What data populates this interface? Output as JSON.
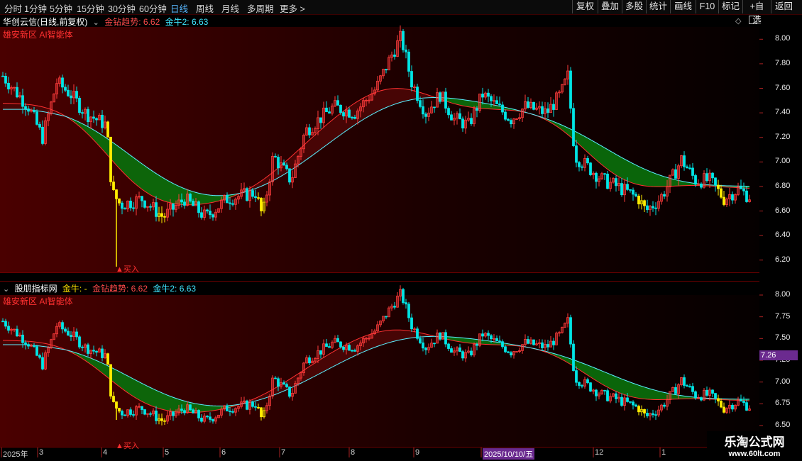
{
  "toolbar": {
    "periods": [
      "分时",
      "1分钟",
      "5分钟",
      "15分钟",
      "30分钟",
      "60分钟",
      "日线",
      "周线",
      "月线",
      "多周期",
      "更多"
    ],
    "more_caret": ">",
    "active_period": "日线",
    "right_buttons": [
      "复权",
      "叠加",
      "多股",
      "统计",
      "画线",
      "F10",
      "标记",
      "+自选",
      "返回"
    ]
  },
  "panel1": {
    "stock_title": "华创云信(日线,前复权)",
    "ind1_label": "金钻趋势:",
    "ind1_value": "6.62",
    "ind2_label": "金牛2:",
    "ind2_value": "6.63",
    "watermark": "雄安新区 AI智能体",
    "buy_label": "▲买入",
    "y_ticks": [
      "8.00",
      "7.80",
      "7.60",
      "7.40",
      "7.20",
      "7.00",
      "6.80",
      "6.60",
      "6.40",
      "6.20"
    ]
  },
  "panel2": {
    "title": "股朋指标网",
    "ind0_label": "金牛:",
    "ind0_value": "-",
    "ind1_label": "金钻趋势:",
    "ind1_value": "6.62",
    "ind2_label": "金牛2:",
    "ind2_value": "6.63",
    "watermark": "雄安新区 AI智能体",
    "buy_label": "▲买入",
    "y_ticks": [
      "8.00",
      "7.75",
      "7.50",
      "7.25",
      "7.00",
      "6.75",
      "6.50"
    ],
    "cursor_price": "7.26"
  },
  "x_axis": {
    "labels": [
      "2025年",
      "3",
      "4",
      "5",
      "6",
      "7",
      "8",
      "9",
      "2025/10/10/五",
      "12",
      "1"
    ]
  },
  "brand": {
    "name": "乐淘公式网",
    "url": "www.60lt.com"
  },
  "colors": {
    "up": "#ff3b3b",
    "down": "#00e5e5",
    "signal": "#ffee00",
    "trend_band_green": "#0b6a0b",
    "trend_band_red": "#4a0505",
    "cursor_label_bg": "#6b2a8f"
  }
}
